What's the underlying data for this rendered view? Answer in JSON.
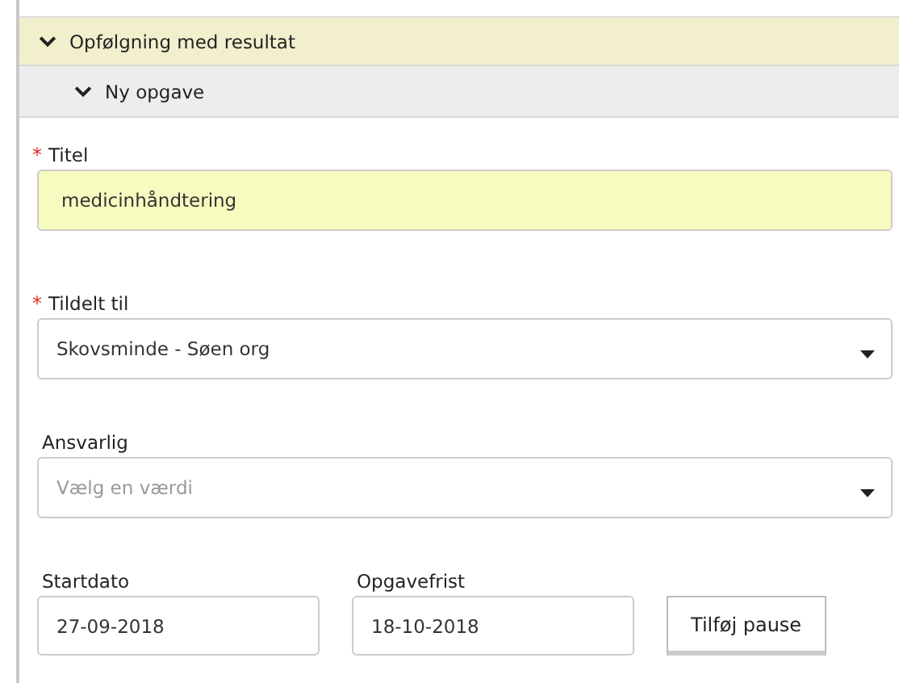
{
  "sections": [
    {
      "title": "Opfølgning med resultat",
      "expanded": true,
      "kind": "primary"
    },
    {
      "title": "Ny opgave",
      "expanded": true,
      "kind": "secondary"
    }
  ],
  "fields": [
    {
      "label": "Titel",
      "required_mark": "*",
      "kind": "text",
      "value": "medicinhåndtering",
      "highlighted": true
    },
    {
      "label": "Tildelt til",
      "required_mark": "*",
      "kind": "select",
      "value": "Skovsminde - Søen org",
      "highlighted": false
    },
    {
      "label": "Ansvarlig",
      "kind": "select",
      "placeholder": "Vælg en værdi",
      "highlighted": false
    }
  ],
  "date_fields": [
    {
      "label": "Startdato",
      "value": "27-09-2018"
    },
    {
      "label": "Opgavefrist",
      "value": "18-10-2018"
    }
  ],
  "buttons": [
    "Tilføj pause"
  ]
}
